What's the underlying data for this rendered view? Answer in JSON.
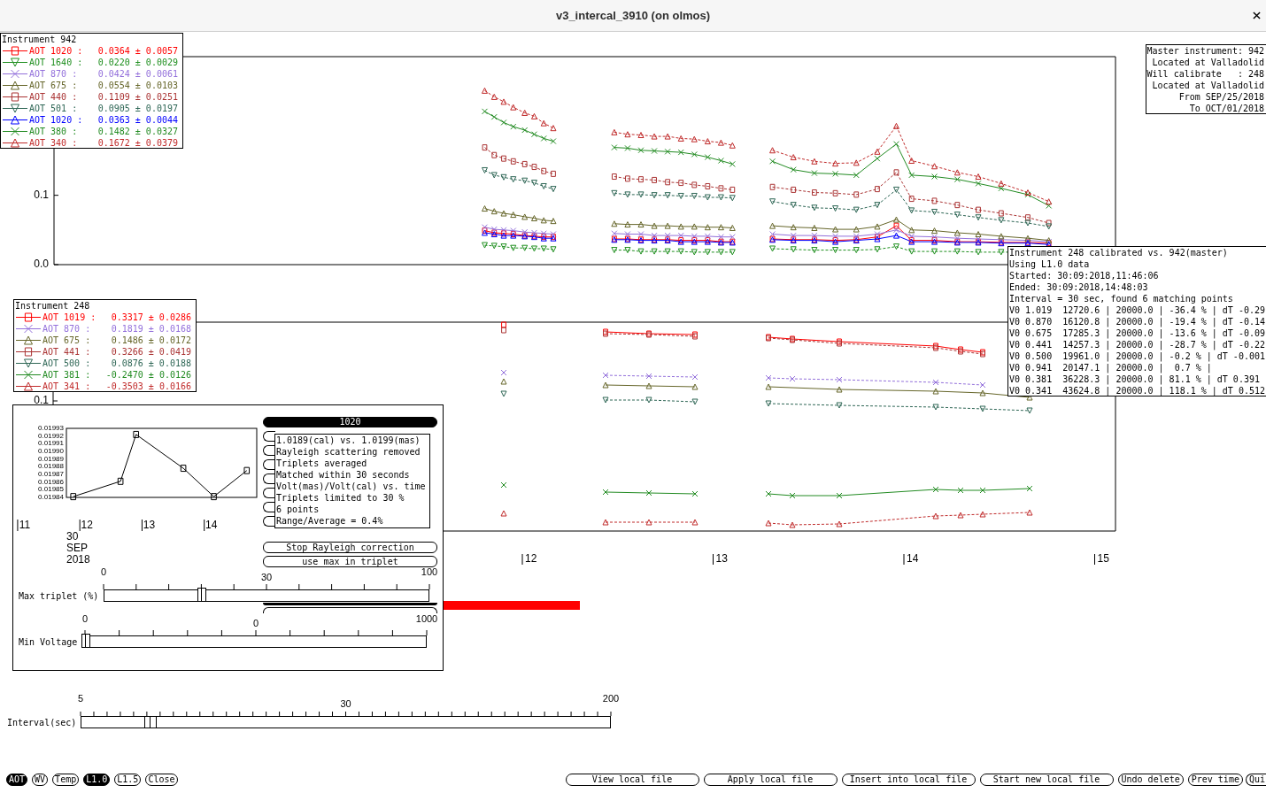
{
  "window": {
    "title": "v3_intercal_3910 (on olmos)"
  },
  "master_legend": {
    "title": "Instrument 942",
    "items": [
      {
        "label": "AOT 1020 :",
        "value": "0.0364 ± 0.0057",
        "color": "#ff0000",
        "kind": "square"
      },
      {
        "label": "AOT 1640 :",
        "value": "0.0220 ± 0.0029",
        "color": "#1f8f1f",
        "kind": "inverted"
      },
      {
        "label": "AOT 870 :",
        "value": "0.0424 ± 0.0061",
        "color": "#9370db",
        "kind": "cross"
      },
      {
        "label": "AOT 675 :",
        "value": "0.0554 ± 0.0103",
        "color": "#66662a",
        "kind": "triangle"
      },
      {
        "label": "AOT 440 :",
        "value": "0.1109 ± 0.0251",
        "color": "#aa3333",
        "kind": "square"
      },
      {
        "label": "AOT 501 :",
        "value": "0.0905 ± 0.0197",
        "color": "#2e6655",
        "kind": "inverted"
      },
      {
        "label": "AOT 1020 :",
        "value": "0.0363 ± 0.0044",
        "color": "#0000ff",
        "kind": "triangle"
      },
      {
        "label": "AOT 380 :",
        "value": "0.1482 ± 0.0327",
        "color": "#228b22",
        "kind": "cross"
      },
      {
        "label": "AOT 340 :",
        "value": "0.1672 ± 0.0379",
        "color": "#c02a2a",
        "kind": "triangle"
      }
    ]
  },
  "top_plot": {
    "y_tick_labels": [
      "0.1",
      "0.0"
    ]
  },
  "calibrated_legend": {
    "title": "Instrument 248",
    "items": [
      {
        "label": "AOT 1019 :",
        "value": "0.3317 ± 0.0286",
        "color": "#ff0000",
        "kind": "square"
      },
      {
        "label": "AOT 870 :",
        "value": "0.1819 ± 0.0168",
        "color": "#9370db",
        "kind": "cross"
      },
      {
        "label": "AOT 675 :",
        "value": "0.1486 ± 0.0172",
        "color": "#66662a",
        "kind": "triangle"
      },
      {
        "label": "AOT 441 :",
        "value": "0.3266 ± 0.0419",
        "color": "#aa3333",
        "kind": "square"
      },
      {
        "label": "AOT 500 :",
        "value": "0.0876 ± 0.0188",
        "color": "#2e6655",
        "kind": "inverted"
      },
      {
        "label": "AOT 381 :",
        "value": "-0.2470 ± 0.0126",
        "color": "#228b22",
        "kind": "cross"
      },
      {
        "label": "AOT 341 :",
        "value": "-0.3503 ± 0.0166",
        "color": "#c02a2a",
        "kind": "triangle"
      }
    ]
  },
  "bottom_plot": {
    "y_tick_labels": [
      "0.1"
    ],
    "x_tick_labels": [
      "12",
      "13",
      "14",
      "15"
    ]
  },
  "master_info": {
    "lines": [
      "Master instrument: 942",
      "Located at Valladolid",
      "Will calibrate   : 248",
      "Located at Valladolid",
      "From SEP/25/2018",
      "To OCT/01/2018"
    ]
  },
  "calibration_info": {
    "lines": [
      "Instrument 248 calibrated vs. 942(master)",
      "Using L1.0 data",
      "Started: 30:09:2018,11:46:06",
      "Ended: 30:09:2018,14:48:03",
      "Interval = 30 sec, found 6 matching points",
      "V0 1.019  12720.6 | 20000.0 | -36.4 % | dT -0.29",
      "V0 0.870  16120.8 | 20000.0 | -19.4 % | dT -0.14",
      "V0 0.675  17285.3 | 20000.0 | -13.6 % | dT -0.09",
      "V0 0.441  14257.3 | 20000.0 | -28.7 % | dT -0.22",
      "V0 0.500  19961.0 | 20000.0 | -0.2 % | dT -0.001",
      "V0 0.941  20147.1 | 20000.0 |  0.7 % |",
      "V0 0.381  36228.3 | 20000.0 | 81.1 % | dT 0.391",
      "V0 0.341  43624.8 | 20000.0 | 118.1 % | dT 0.512"
    ]
  },
  "ratio_panel": {
    "chart_data": {
      "type": "line",
      "x": [
        11.78,
        12.54,
        12.79,
        13.55,
        14.04,
        14.57
      ],
      "xlim": [
        11.67,
        14.73
      ],
      "ylim": [
        0.01984,
        0.01993
      ],
      "xticks": [
        {
          "value": 12,
          "label": "12"
        },
        {
          "value": 13,
          "label": "13"
        },
        {
          "value": 14,
          "label": "14"
        }
      ],
      "yticks": [
        {
          "value": 0.01993,
          "label": "0.01993"
        },
        {
          "value": 0.01992,
          "label": "0.01992"
        },
        {
          "value": 0.01991,
          "label": "0.01991"
        },
        {
          "value": 0.0199,
          "label": "0.01990"
        },
        {
          "value": 0.01989,
          "label": "0.01989"
        },
        {
          "value": 0.01988,
          "label": "0.01988"
        },
        {
          "value": 0.01987,
          "label": "0.01987"
        },
        {
          "value": 0.01986,
          "label": "0.01986"
        },
        {
          "value": 0.01985,
          "label": "0.01985"
        },
        {
          "value": 0.01984,
          "label": "0.01984"
        }
      ],
      "series": [
        {
          "color": "#000000",
          "marker": "square",
          "values": [
            0.019841,
            0.019861,
            0.019922,
            0.019878,
            0.019841,
            0.019875
          ]
        }
      ]
    },
    "hour_before_frame": "11",
    "date_lines": [
      "30",
      "SEP",
      "2018"
    ],
    "band_buttons": [
      {
        "label": "1020",
        "selected": true
      },
      {
        "selected": false
      },
      {
        "selected": false
      },
      {
        "selected": false
      },
      {
        "selected": false
      },
      {
        "selected": false
      },
      {
        "selected": false
      },
      {
        "selected": false
      }
    ],
    "tooltip": {
      "lines": [
        "1.0189(cal) vs. 1.0199(mas)",
        "Rayleigh scattering removed",
        "Triplets averaged",
        "Matched within 30 seconds",
        "Volt(mas)/Volt(cal) vs. time",
        "Triplets limited to 30 %",
        "6 points",
        "Range/Average = 0.4%"
      ]
    },
    "option_buttons": [
      "Stop Rayleigh correction",
      "use max in triplet"
    ],
    "max_triplet": {
      "label": "Max triplet (%)",
      "min": "0",
      "value": "30",
      "max": "100",
      "level": 0.3
    },
    "min_voltage": {
      "label": "Min Voltage",
      "min": "0",
      "value": "0",
      "max": "1000",
      "level": 0
    }
  },
  "interval_slider": {
    "label": "Interval(sec)",
    "min": "5",
    "value": "30",
    "max": "200",
    "level": 0.13
  },
  "mode_buttons": [
    {
      "label": "AOT",
      "selected": true
    },
    {
      "label": "WV",
      "selected": false
    },
    {
      "label": "Temp",
      "selected": false
    },
    {
      "label": "L1.0",
      "selected": true
    },
    {
      "label": "L1.5",
      "selected": false
    },
    {
      "label": "Close",
      "selected": false
    }
  ],
  "file_buttons": [
    "View local file",
    "Apply local file",
    "Insert into local file",
    "Start new local file"
  ],
  "action_buttons": [
    "Undo delete",
    "Prev time",
    "Qui"
  ]
}
